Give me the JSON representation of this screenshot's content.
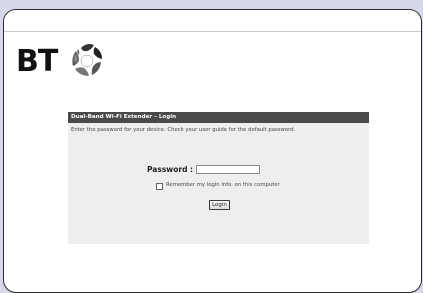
{
  "brand": {
    "logo_text": "BT",
    "accent": "#4a4a4a"
  },
  "login": {
    "header": "Dual-Band Wi-Fi Extender – Login",
    "intro": "Enter the password for your device. Check your user guide for the default password.",
    "password_label": "Password :",
    "password_value": "",
    "remember_label": "Remember my login info. on this computer",
    "remember_checked": false,
    "login_button": "Login"
  }
}
